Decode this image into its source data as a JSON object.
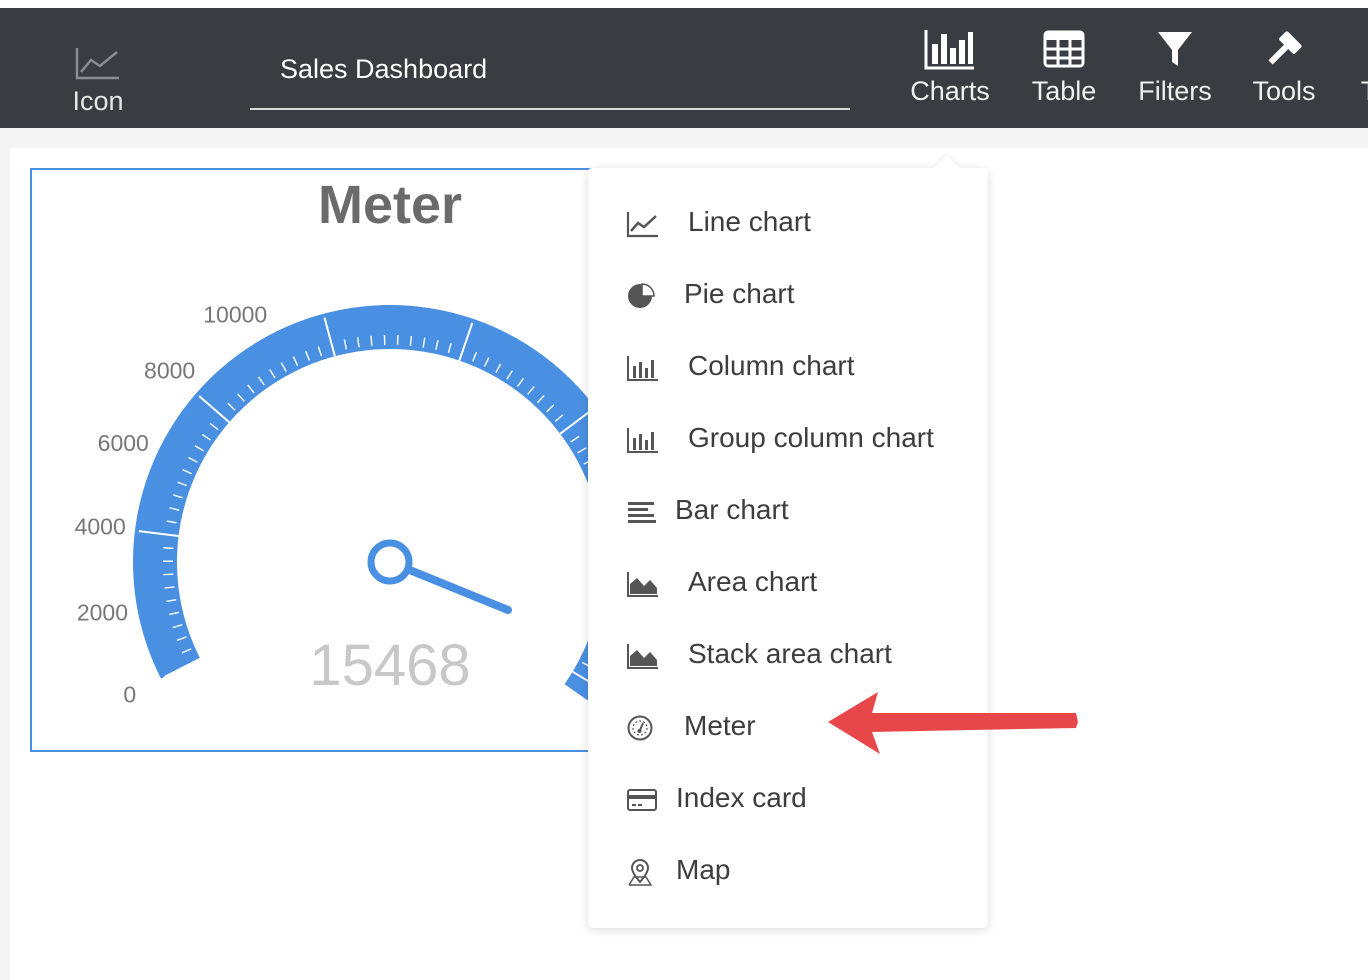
{
  "toolbar": {
    "icon_label": "Icon",
    "dashboard_title": "Sales Dashboard",
    "buttons": [
      {
        "label": "Charts",
        "icon": "bar-chart-icon"
      },
      {
        "label": "Table",
        "icon": "table-grid-icon"
      },
      {
        "label": "Filters",
        "icon": "funnel-icon"
      },
      {
        "label": "Tools",
        "icon": "hammer-icon"
      },
      {
        "label": "T",
        "icon": ""
      }
    ]
  },
  "widget": {
    "title": "Meter",
    "value": "15468",
    "scale_labels": [
      "0",
      "2000",
      "4000",
      "6000",
      "8000",
      "10000"
    ],
    "accent_color": "#4a90e2"
  },
  "chart_data": {
    "type": "gauge",
    "title": "Meter",
    "value": 15468,
    "ticks": [
      0,
      2000,
      4000,
      6000,
      8000,
      10000
    ]
  },
  "menu": {
    "items": [
      {
        "label": "Line chart",
        "icon": "line-chart-icon"
      },
      {
        "label": "Pie chart",
        "icon": "pie-chart-icon"
      },
      {
        "label": "Column chart",
        "icon": "column-chart-icon"
      },
      {
        "label": "Group column chart",
        "icon": "group-column-chart-icon"
      },
      {
        "label": "Bar chart",
        "icon": "bar-chart-icon"
      },
      {
        "label": "Area chart",
        "icon": "area-chart-icon"
      },
      {
        "label": "Stack area chart",
        "icon": "stack-area-chart-icon"
      },
      {
        "label": "Meter",
        "icon": "meter-icon"
      },
      {
        "label": "Index card",
        "icon": "index-card-icon"
      },
      {
        "label": "Map",
        "icon": "map-pin-icon"
      }
    ]
  },
  "annotation": {
    "color": "#e8474a"
  }
}
